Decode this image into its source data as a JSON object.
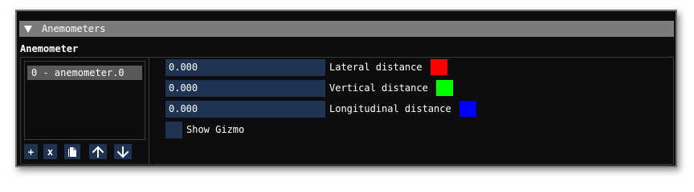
{
  "header": {
    "title": "Anemometers"
  },
  "section": {
    "label": "Anemometer"
  },
  "list": {
    "items": [
      {
        "label": "0 - anemometer.0"
      }
    ]
  },
  "toolbar": {
    "add_label": "+",
    "remove_label": "x",
    "duplicate_icon": "copy-icon",
    "move_up_icon": "arrow-up-icon",
    "move_down_icon": "arrow-down-icon"
  },
  "fields": [
    {
      "value": "0.000",
      "label": "Lateral distance",
      "color": "#ff0000"
    },
    {
      "value": "0.000",
      "label": "Vertical distance",
      "color": "#00ff00"
    },
    {
      "value": "0.000",
      "label": "Longitudinal distance",
      "color": "#0000ff"
    }
  ],
  "gizmo": {
    "label": "Show Gizmo",
    "checked": false
  },
  "colors": {
    "window_bg": "#0d0d0f",
    "header_bg": "#7b7b7b",
    "input_bg": "#1f3453",
    "selected_item_bg": "#595959"
  }
}
